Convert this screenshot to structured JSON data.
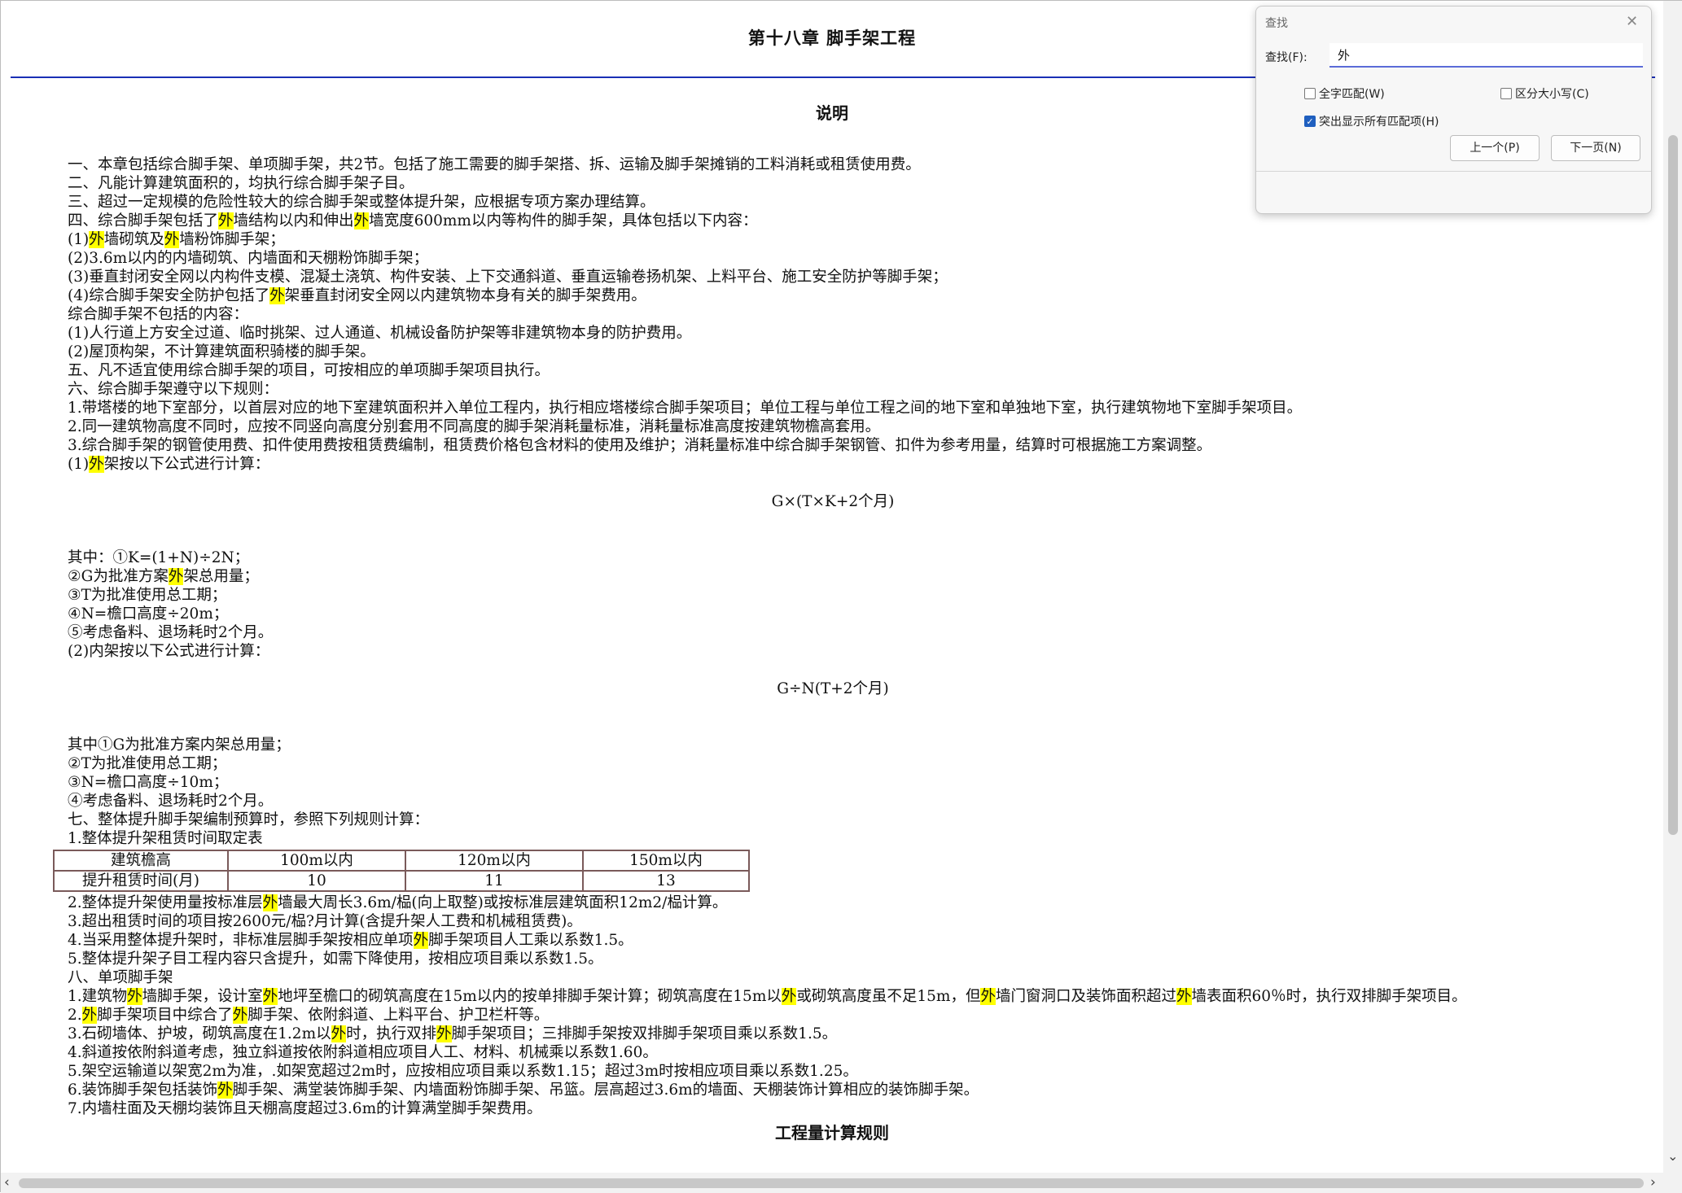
{
  "document": {
    "chapter_title": "第十八章  脚手架工程",
    "section_title": "说明",
    "next_section_title": "工程量计算规则",
    "lines": [
      {
        "text": "一、本章包括综合脚手架、单项脚手架，共2节。包括了施工需要的脚手架搭、拆、运输及脚手架摊销的工料消耗或租赁使用费。"
      },
      {
        "text": "二、凡能计算建筑面积的，均执行综合脚手架子目。"
      },
      {
        "text": "三、超过一定规模的危险性较大的综合脚手架或整体提升架，应根据专项方案办理结算。"
      },
      {
        "text": "四、综合脚手架包括了[外]墙结构以内和伸出[外]墙宽度600mm以内等构件的脚手架，具体包括以下内容："
      },
      {
        "text": "(1)[外]墙砌筑及[外]墙粉饰脚手架；"
      },
      {
        "text": "(2)3.6m以内的内墙砌筑、内墙面和天棚粉饰脚手架；"
      },
      {
        "text": "(3)垂直封闭安全网以内构件支模、混凝土浇筑、构件安装、上下交通斜道、垂直运输卷扬机架、上料平台、施工安全防护等脚手架；"
      },
      {
        "text": "(4)综合脚手架安全防护包括了[外]架垂直封闭安全网以内建筑物本身有关的脚手架费用。"
      },
      {
        "text": "综合脚手架不包括的内容："
      },
      {
        "text": "(1)人行道上方安全过道、临时挑架、过人通道、机械设备防护架等非建筑物本身的防护费用。"
      },
      {
        "text": "(2)屋顶构架，不计算建筑面积骑楼的脚手架。"
      },
      {
        "text": "五、凡不适宜使用综合脚手架的项目，可按相应的单项脚手架项目执行。"
      },
      {
        "text": "六、综合脚手架遵守以下规则："
      },
      {
        "text": "1.带塔楼的地下室部分，以首层对应的地下室建筑面积并入单位工程内，执行相应塔楼综合脚手架项目；单位工程与单位工程之间的地下室和单独地下室，执行建筑物地下室脚手架项目。"
      },
      {
        "text": "2.同一建筑物高度不同时，应按不同竖向高度分别套用不同高度的脚手架消耗量标准，消耗量标准高度按建筑物檐高套用。"
      },
      {
        "text": "3.综合脚手架的钢管使用费、扣件使用费按租赁费编制，租赁费价格包含材料的使用及维护；消耗量标准中综合脚手架钢管、扣件为参考用量，结算时可根据施工方案调整。"
      },
      {
        "text": "(1)[外]架按以下公式进行计算："
      },
      {
        "kind": "blank"
      },
      {
        "kind": "formula",
        "text": "G×(T×K+2个月)"
      },
      {
        "kind": "blank"
      },
      {
        "kind": "blank"
      },
      {
        "text": "其中：①K=(1+N)÷2N；"
      },
      {
        "text": "②G为批准方案[外]架总用量；"
      },
      {
        "text": "③T为批准使用总工期；"
      },
      {
        "text": "④N=檐口高度÷20m；"
      },
      {
        "text": "⑤考虑备料、退场耗时2个月。"
      },
      {
        "text": "(2)内架按以下公式进行计算："
      },
      {
        "kind": "blank"
      },
      {
        "kind": "formula",
        "text": "G÷N(T+2个月)"
      },
      {
        "kind": "blank"
      },
      {
        "kind": "blank"
      },
      {
        "text": "其中①G为批准方案内架总用量；"
      },
      {
        "text": "②T为批准使用总工期；"
      },
      {
        "text": "③N=檐口高度÷10m；"
      },
      {
        "text": "④考虑备料、退场耗时2个月。"
      },
      {
        "text": "七、整体提升脚手架编制预算时，参照下列规则计算："
      },
      {
        "text": "1.整体提升架租赁时间取定表"
      },
      {
        "kind": "table",
        "rows": [
          [
            "建筑檐高",
            "100m以内",
            "120m以内",
            "150m以内"
          ],
          [
            "提升租赁时间(月)",
            "10",
            "11",
            "13"
          ]
        ]
      },
      {
        "text": "2.整体提升架使用量按标准层[外]墙最大周长3.6m/榀(向上取整)或按标准层建筑面积12m2/榀计算。"
      },
      {
        "text": "3.超出租赁时间的项目按2600元/榀?月计算(含提升架人工费和机械租赁费)。"
      },
      {
        "text": "4.当采用整体提升架时，非标准层脚手架按相应单项[外]脚手架项目人工乘以系数1.5。"
      },
      {
        "text": "5.整体提升架子目工程内容只含提升，如需下降使用，按相应项目乘以系数1.5。"
      },
      {
        "text": "八、单项脚手架"
      },
      {
        "text": "1.建筑物[外]墙脚手架，设计室[外]地坪至檐口的砌筑高度在15m以内的按单排脚手架计算；砌筑高度在15m以[外]或砌筑高度虽不足15m，但[外]墙门窗洞口及装饰面积超过[外]墙表面积60％时，执行双排脚手架项目。"
      },
      {
        "text": "2.[外]脚手架项目中综合了[外]脚手架、依附斜道、上料平台、护卫栏杆等。"
      },
      {
        "text": "3.石砌墙体、护坡，砌筑高度在1.2m以[外]时，执行双排[外]脚手架项目；三排脚手架按双排脚手架项目乘以系数1.5。"
      },
      {
        "text": "4.斜道按依附斜道考虑，独立斜道按依附斜道相应项目人工、材料、机械乘以系数1.60。"
      },
      {
        "text": "5.架空运输道以架宽2m为准，.如架宽超过2m时，应按相应项目乘以系数1.15；超过3m时按相应项目乘以系数1.25。"
      },
      {
        "text": "6.装饰脚手架包括装饰[外]脚手架、满堂装饰脚手架、内墙面粉饰脚手架、吊篮。层高超过3.6m的墙面、天棚装饰计算相应的装饰脚手架。"
      },
      {
        "text": "7.内墙柱面及天棚均装饰且天棚高度超过3.6m的计算满堂脚手架费用。"
      }
    ]
  },
  "find_dialog": {
    "title": "查找",
    "find_label": "查找(F):",
    "query": "外",
    "whole_word_label": "全字匹配(W)",
    "whole_word_checked": false,
    "match_case_label": "区分大小写(C)",
    "match_case_checked": false,
    "highlight_all_label": "突出显示所有匹配项(H)",
    "highlight_all_checked": true,
    "prev_label": "上一个(P)",
    "next_label": "下一页(N)",
    "close_icon": "close-icon",
    "accent_color": "#1f5fbf"
  },
  "highlight_color": "#ffff00",
  "rule_color": "#1a2fb5"
}
